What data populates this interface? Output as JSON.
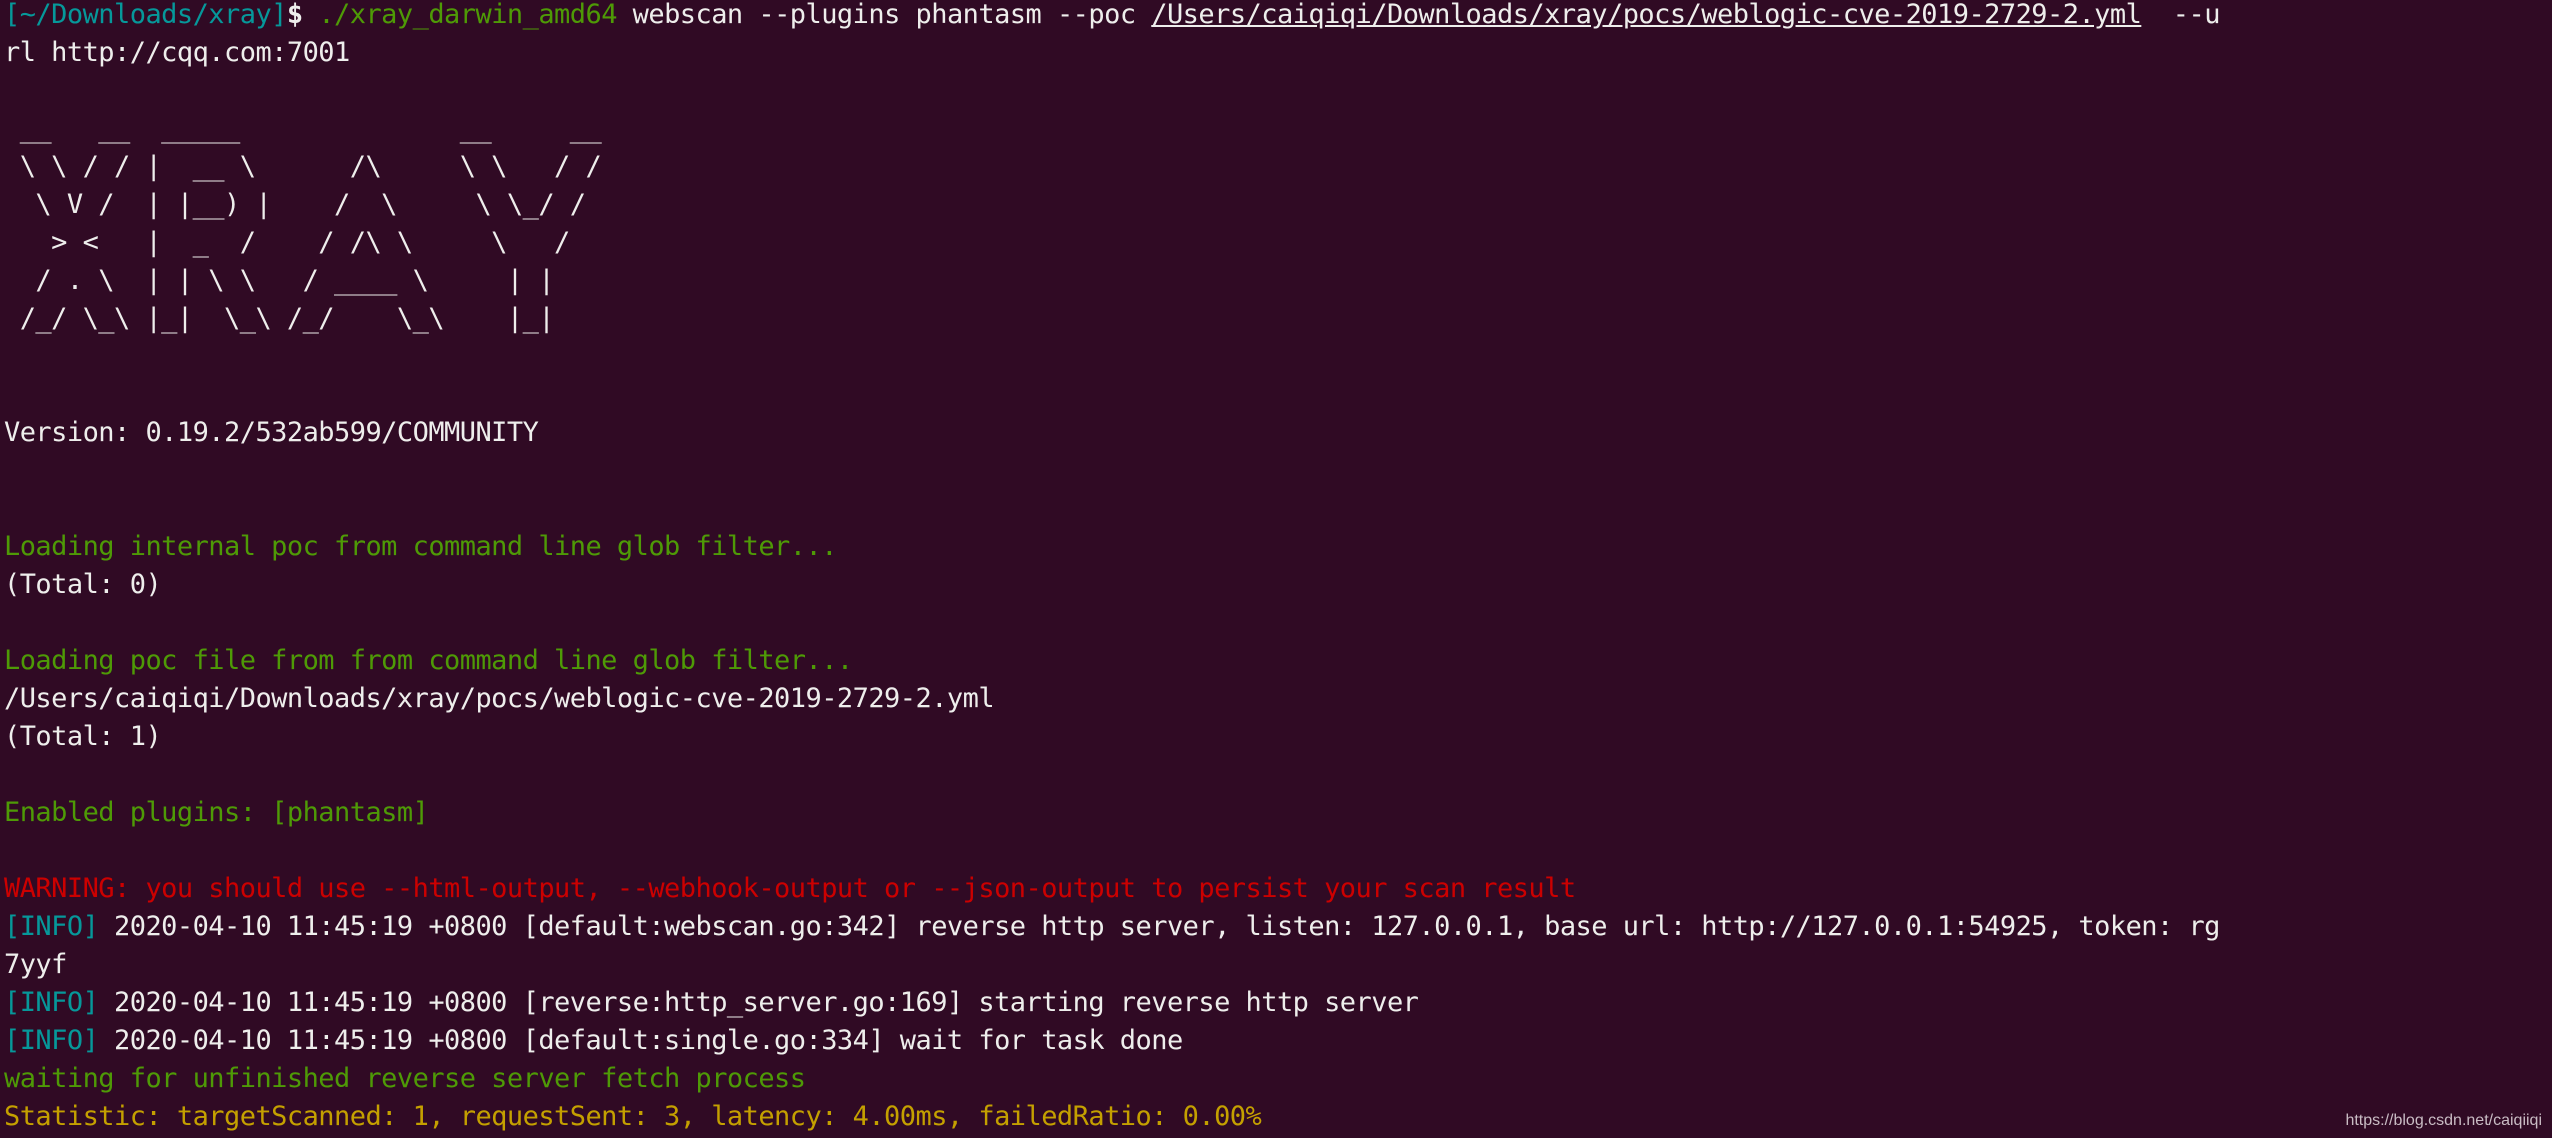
{
  "terminal": {
    "prompt": {
      "cwd": "[~/Downloads/xray]",
      "symbol": "$",
      "binary": " ./xray_darwin_amd64",
      "args_pre": " webscan --plugins phantasm --poc ",
      "poc_path": "/Users/caiqiqi/Downloads/xray/pocs/weblogic-cve-2019-2729-2.yml",
      "args_post": "  --u",
      "wrap": "rl http://cqq.com:7001"
    },
    "banner": [
      " __   __  _____              __     __",
      " \\ \\ / / |  __ \\      /\\     \\ \\   / /",
      "  \\ V /  | |__) |    /  \\     \\ \\_/ /",
      "   > <   |  _  /    / /\\ \\     \\   /",
      "  / . \\  | | \\ \\   / ____ \\     | |",
      " /_/ \\_\\ |_|  \\_\\ /_/    \\_\\    |_|"
    ],
    "version": "Version: 0.19.2/532ab599/COMMUNITY",
    "loading_internal": "Loading internal poc from command line glob filter...",
    "total_internal": "(Total: 0)",
    "loading_file": "Loading poc file from from command line glob filter...",
    "poc_file": "/Users/caiqiqi/Downloads/xray/pocs/weblogic-cve-2019-2729-2.yml",
    "total_file": "(Total: 1)",
    "enabled_plugins": "Enabled plugins: [phantasm]",
    "warning": "WARNING: you should use --html-output, --webhook-output or --json-output to persist your scan result",
    "info_tag": "[INFO]",
    "info": [
      {
        "text": " 2020-04-10 11:45:19 +0800 [default:webscan.go:342] reverse http server, listen: 127.0.0.1, base url: http://127.0.0.1:54925, token: rg",
        "wrap": "7yyf"
      },
      {
        "text": " 2020-04-10 11:45:19 +0800 [reverse:http_server.go:169] starting reverse http server"
      },
      {
        "text": " 2020-04-10 11:45:19 +0800 [default:single.go:334] wait for task done"
      }
    ],
    "waiting": "waiting for unfinished reverse server fetch process",
    "statistic": "Statistic: targetScanned: 1, requestSent: 3, latency: 4.00ms, failedRatio: 0.00%"
  },
  "watermark": "https://blog.csdn.net/caiqiiqi"
}
